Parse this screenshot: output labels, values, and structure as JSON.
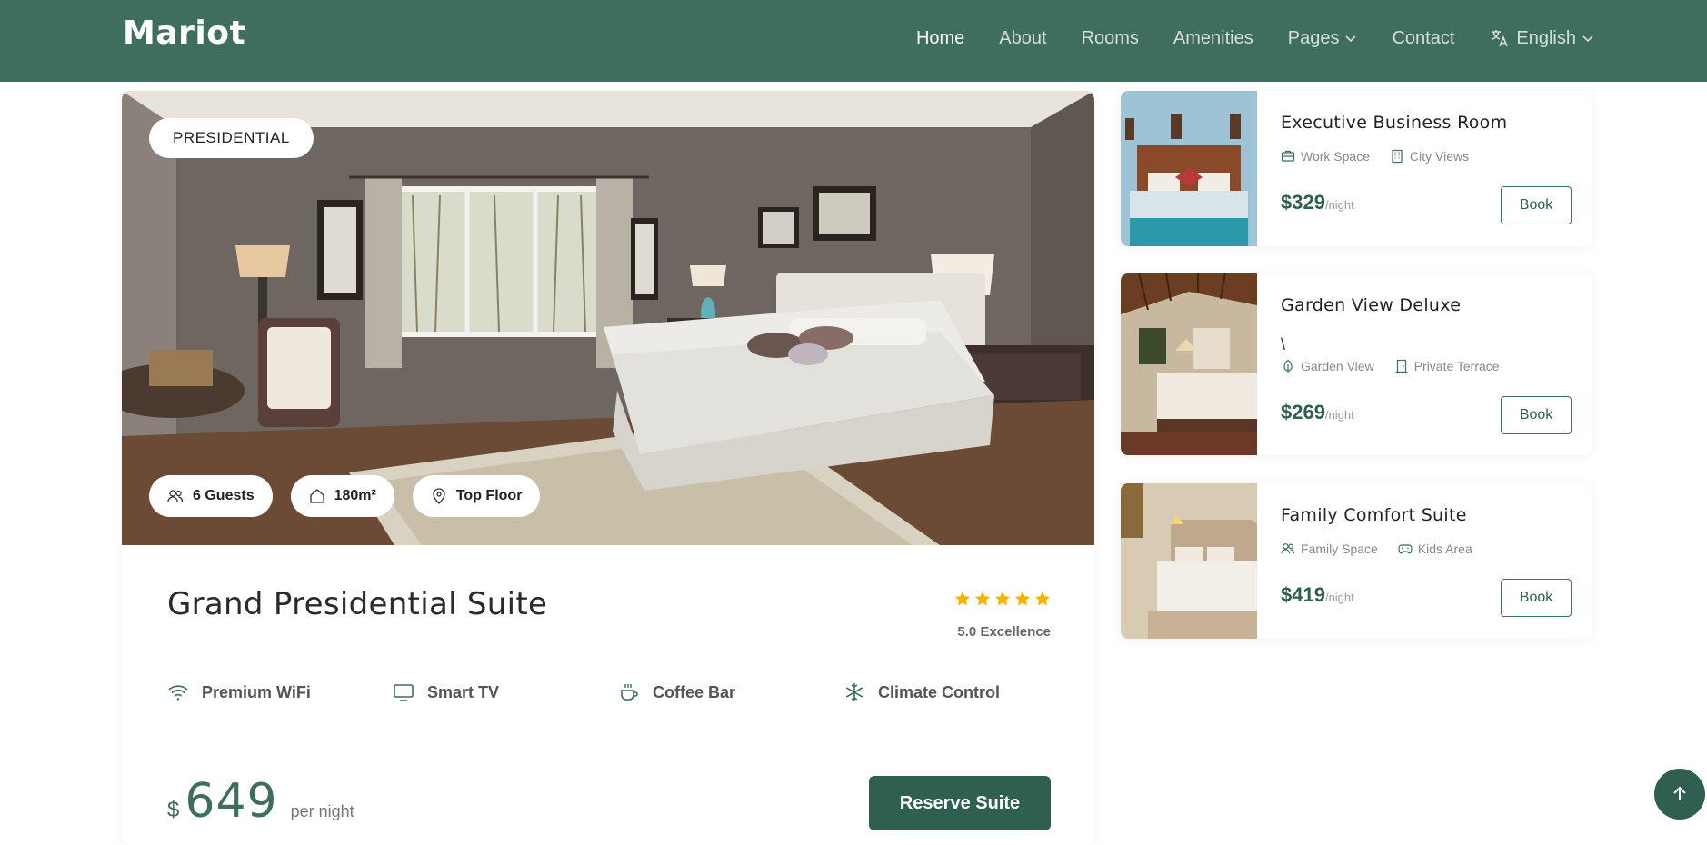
{
  "brand": {
    "logo": "Mariot",
    "accent": "#3f6e5d",
    "accent_dark": "#2f5f51",
    "star_color": "#f5b301"
  },
  "nav": {
    "items": [
      {
        "label": "Home",
        "active": true
      },
      {
        "label": "About"
      },
      {
        "label": "Rooms"
      },
      {
        "label": "Amenities"
      },
      {
        "label": "Pages",
        "icon": "chevron-down-icon"
      },
      {
        "label": "Contact"
      }
    ],
    "language": {
      "label": "English",
      "icon": "translate-icon"
    }
  },
  "featured": {
    "badge": "PRESIDENTIAL",
    "chips": [
      {
        "label": "6 Guests",
        "icon": "users-icon"
      },
      {
        "label": "180m²",
        "icon": "home-icon"
      },
      {
        "label": "Top Floor",
        "icon": "map-pin-icon"
      }
    ],
    "title": "Grand Presidential Suite",
    "rating": {
      "stars": 5,
      "text": "5.0 Excellence"
    },
    "amenities": [
      {
        "label": "Premium WiFi",
        "icon": "wifi-icon"
      },
      {
        "label": "Smart TV",
        "icon": "tv-icon"
      },
      {
        "label": "Coffee Bar",
        "icon": "coffee-icon"
      },
      {
        "label": "Climate Control",
        "icon": "snowflake-icon"
      }
    ],
    "price": {
      "currency": "$",
      "amount": "649",
      "unit": "per night"
    },
    "reserve_label": "Reserve Suite"
  },
  "side_rooms": [
    {
      "title": "Executive Business Room",
      "features": [
        {
          "label": "Work Space",
          "icon": "briefcase-icon"
        },
        {
          "label": "City Views",
          "icon": "building-icon"
        }
      ],
      "price": "$329",
      "unit": "/night",
      "book_label": "Book"
    },
    {
      "title": "Garden View Deluxe",
      "extra": "\\",
      "features": [
        {
          "label": "Garden View",
          "icon": "leaf-icon"
        },
        {
          "label": "Private Terrace",
          "icon": "door-icon"
        }
      ],
      "price": "$269",
      "unit": "/night",
      "book_label": "Book"
    },
    {
      "title": "Family Comfort Suite",
      "features": [
        {
          "label": "Family Space",
          "icon": "users-icon"
        },
        {
          "label": "Kids Area",
          "icon": "gamepad-icon"
        }
      ],
      "price": "$419",
      "unit": "/night",
      "book_label": "Book"
    }
  ],
  "scroll_top": {
    "icon": "arrow-up-icon"
  }
}
